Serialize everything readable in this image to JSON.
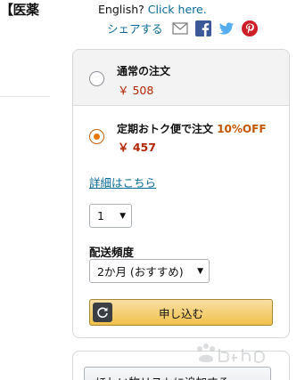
{
  "left_fragment": "【医薬",
  "top": {
    "english_prefix": "English?",
    "english_link": "Click here.",
    "share_label": "シェアする",
    "share_icons": [
      "email-icon",
      "facebook-icon",
      "twitter-icon",
      "pinterest-icon"
    ]
  },
  "buybox": {
    "regular": {
      "title": "通常の注文",
      "price": "￥ 508",
      "selected": false
    },
    "subscribe": {
      "title": "定期おトク便で注文",
      "discount": "10%OFF",
      "price": "￥ 457",
      "selected": true
    },
    "details_link": "詳細はこちら",
    "quantity": {
      "value": "1"
    },
    "frequency_label": "配送頻度",
    "frequency": {
      "value": "2か月 (おすすめ)"
    },
    "subscribe_button": "申し込む"
  },
  "wishlist": {
    "button_label": "ほしい物リストに追加する"
  },
  "colors": {
    "link": "#0a6b97",
    "price": "#b12704",
    "discount": "#c45500",
    "button_top": "#f7dfa5",
    "button_bottom": "#f0c14b"
  }
}
